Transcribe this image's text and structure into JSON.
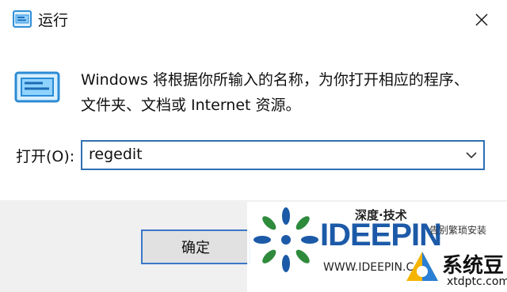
{
  "window": {
    "title": "运行",
    "close_symbol": "✕"
  },
  "description": {
    "line1": "Windows 将根据你所输入的名称，为你打开相应的程序、",
    "line2": "文件夹、文档或 Internet 资源。"
  },
  "open_field": {
    "label": "打开(O):",
    "value": "regedit"
  },
  "buttons": {
    "ok": "确定"
  },
  "watermark": {
    "cn_title": "深度·技术",
    "brand": "IDEEPIN",
    "side_text": "告别繁琐安装",
    "url": "WWW.IDEEPIN.C",
    "site_name": "系统豆",
    "site_domain": "xtdptc.com"
  },
  "icons": [
    "run-app-icon",
    "close-icon",
    "run-large-icon",
    "chevron-down-icon",
    "ideepin-logo-icon",
    "xtdptc-logo-icon"
  ],
  "colors": {
    "focus_border": "#2f6fb3",
    "button_face": "#e1e1e1",
    "footer_bg": "#f0f0f0",
    "brand_blue": "#1c5aa8"
  }
}
